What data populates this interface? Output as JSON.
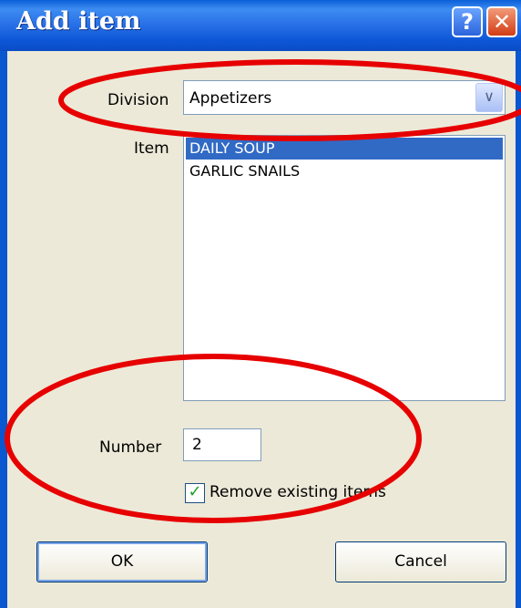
{
  "dialog": {
    "title": "Add item",
    "help_glyph": "?",
    "close_glyph": "✕"
  },
  "form": {
    "division_label": "Division",
    "division_value": "Appetizers",
    "item_label": "Item",
    "items": [
      {
        "label": "DAILY SOUP",
        "selected": true
      },
      {
        "label": "GARLIC SNAILS",
        "selected": false
      }
    ],
    "number_label": "Number",
    "number_value": "2",
    "remove_existing_label": "Remove existing items",
    "remove_existing_checked": true
  },
  "buttons": {
    "ok": "OK",
    "cancel": "Cancel"
  },
  "annotation_color": "#e60000"
}
